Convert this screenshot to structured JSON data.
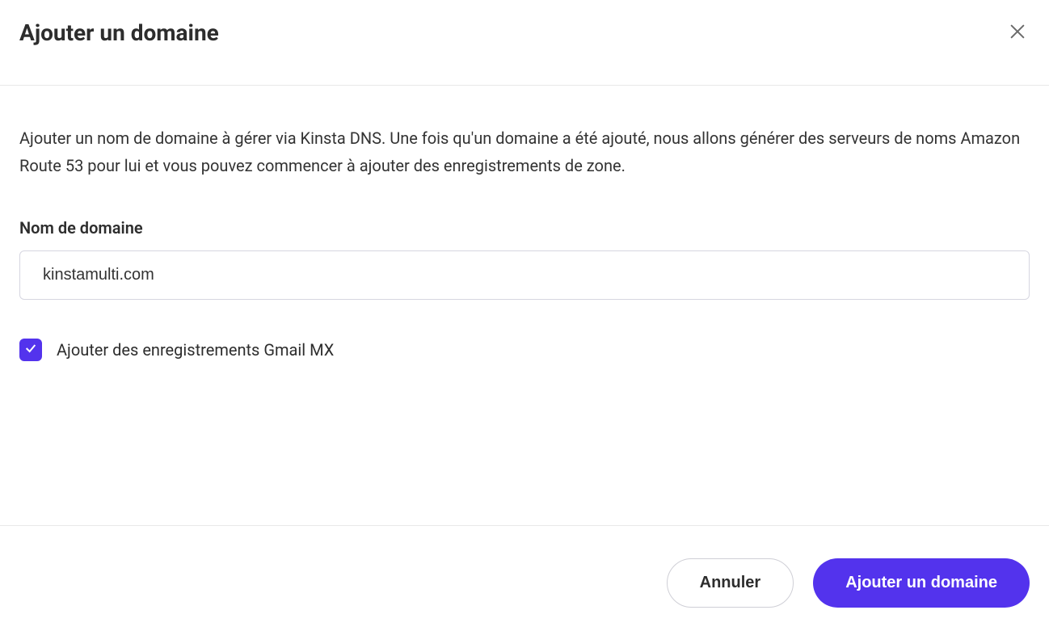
{
  "header": {
    "title": "Ajouter un domaine"
  },
  "body": {
    "description": "Ajouter un nom de domaine à gérer via Kinsta DNS. Une fois qu'un domaine a été ajouté, nous allons générer des serveurs de noms Amazon Route 53 pour lui et vous pouvez commencer à ajouter des enregistrements de zone.",
    "domain_label": "Nom de domaine",
    "domain_value": "kinstamulti.com",
    "checkbox_label": "Ajouter des enregistrements Gmail MX",
    "checkbox_checked": true
  },
  "footer": {
    "cancel_label": "Annuler",
    "submit_label": "Ajouter un domaine"
  },
  "colors": {
    "accent": "#5333ed"
  }
}
